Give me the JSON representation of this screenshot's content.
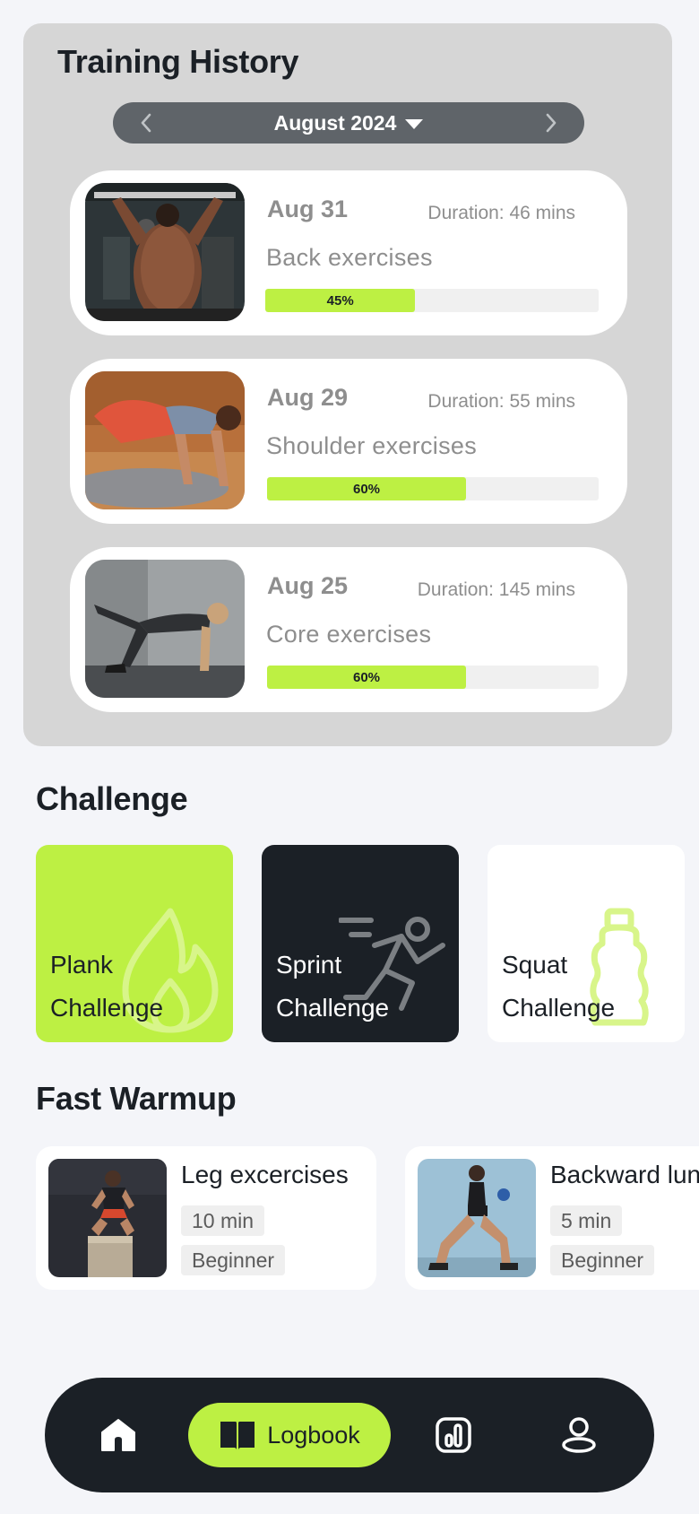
{
  "history": {
    "title": "Training History",
    "month": "August 2024",
    "sessions": [
      {
        "date": "Aug 31",
        "duration": "Duration: 46 mins",
        "name": "Back exercises",
        "progress": 45,
        "progress_label": "45%"
      },
      {
        "date": "Aug 29",
        "duration": "Duration: 55 mins",
        "name": "Shoulder exercises",
        "progress": 60,
        "progress_label": "60%"
      },
      {
        "date": "Aug 25",
        "duration": "Duration: 145 mins",
        "name": "Core exercises",
        "progress": 60,
        "progress_label": "60%"
      }
    ]
  },
  "challenge": {
    "heading": "Challenge",
    "items": [
      {
        "line1": "Plank",
        "line2": "Challenge",
        "icon": "flame-icon",
        "bg": "#bdf043",
        "text_color": "#1b2026"
      },
      {
        "line1": "Sprint",
        "line2": "Challenge",
        "icon": "runner-icon",
        "bg": "#1b2026",
        "text_color": "#ffffff"
      },
      {
        "line1": "Squat",
        "line2": "Challenge",
        "icon": "bottle-icon",
        "bg": "#ffffff",
        "text_color": "#1b2026"
      }
    ]
  },
  "warmup": {
    "heading": "Fast Warmup",
    "items": [
      {
        "title": "Leg excercises",
        "time": "10 min",
        "level": "Beginner"
      },
      {
        "title": "Backward lunge",
        "time": "5 min",
        "level": "Beginner"
      }
    ]
  },
  "nav": {
    "logbook_label": "Logbook",
    "active": "logbook"
  },
  "colors": {
    "accent": "#bdf043",
    "dark": "#1b2026",
    "panel": "#d6d6d6",
    "muted_text": "#8e8e8e"
  }
}
